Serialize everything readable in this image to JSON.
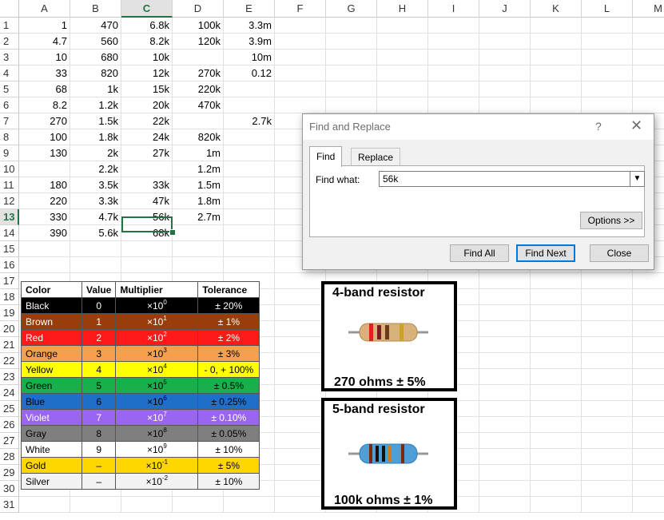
{
  "columns": [
    "A",
    "B",
    "C",
    "D",
    "E",
    "F",
    "G",
    "H",
    "I",
    "J",
    "K",
    "L",
    "M"
  ],
  "rows": [
    "1",
    "2",
    "3",
    "4",
    "5",
    "6",
    "7",
    "8",
    "9",
    "10",
    "11",
    "12",
    "13",
    "14",
    "15",
    "16",
    "17",
    "18",
    "19",
    "20",
    "21",
    "22",
    "23",
    "24",
    "25",
    "26",
    "27",
    "28",
    "29",
    "30",
    "31"
  ],
  "cells": [
    [
      "1",
      "470",
      "6.8k",
      "100k",
      "3.3m"
    ],
    [
      "4.7",
      "560",
      "8.2k",
      "120k",
      "3.9m"
    ],
    [
      "10",
      "680",
      "10k",
      "",
      "10m"
    ],
    [
      "33",
      "820",
      "12k",
      "270k",
      "0.12"
    ],
    [
      "68",
      "1k",
      "15k",
      "220k",
      ""
    ],
    [
      "8.2",
      "1.2k",
      "20k",
      "470k",
      ""
    ],
    [
      "270",
      "1.5k",
      "22k",
      "",
      "2.7k"
    ],
    [
      "100",
      "1.8k",
      "24k",
      "820k",
      ""
    ],
    [
      "130",
      "2k",
      "27k",
      "1m",
      ""
    ],
    [
      "",
      "2.2k",
      "",
      "1.2m",
      ""
    ],
    [
      "180",
      "3.5k",
      "33k",
      "1.5m",
      ""
    ],
    [
      "220",
      "3.3k",
      "47k",
      "1.8m",
      ""
    ],
    [
      "330",
      "4.7k",
      "56k",
      "2.7m",
      ""
    ],
    [
      "390",
      "5.6k",
      "68k",
      "",
      ""
    ]
  ],
  "color_table": {
    "headers": [
      "Color",
      "Value",
      "Multiplier",
      "Tolerance"
    ],
    "rows": [
      {
        "name": "Black",
        "value": "0",
        "exp": "0",
        "tol": "± 20%",
        "bg": "#000000",
        "fg": "#ffffff"
      },
      {
        "name": "Brown",
        "value": "1",
        "exp": "1",
        "tol": "± 1%",
        "bg": "#9a3d0a",
        "fg": "#ffffff"
      },
      {
        "name": "Red",
        "value": "2",
        "exp": "2",
        "tol": "± 2%",
        "bg": "#ff1a1a",
        "fg": "#ffffff"
      },
      {
        "name": "Orange",
        "value": "3",
        "exp": "3",
        "tol": "± 3%",
        "bg": "#f5a04d",
        "fg": "#000000"
      },
      {
        "name": "Yellow",
        "value": "4",
        "exp": "4",
        "tol": "- 0, + 100%",
        "bg": "#ffff00",
        "fg": "#000000"
      },
      {
        "name": "Green",
        "value": "5",
        "exp": "5",
        "tol": "± 0.5%",
        "bg": "#18b04a",
        "fg": "#000000"
      },
      {
        "name": "Blue",
        "value": "6",
        "exp": "6",
        "tol": "± 0.25%",
        "bg": "#1f6fc8",
        "fg": "#000000"
      },
      {
        "name": "Violet",
        "value": "7",
        "exp": "7",
        "tol": "± 0.10%",
        "bg": "#9a66f0",
        "fg": "#ffffff"
      },
      {
        "name": "Gray",
        "value": "8",
        "exp": "8",
        "tol": "± 0.05%",
        "bg": "#7f7f7f",
        "fg": "#000000"
      },
      {
        "name": "White",
        "value": "9",
        "exp": "9",
        "tol": "± 10%",
        "bg": "#ffffff",
        "fg": "#000000"
      },
      {
        "name": "Gold",
        "value": "–",
        "exp": "-1",
        "tol": "± 5%",
        "bg": "#ffd700",
        "fg": "#000000"
      },
      {
        "name": "Silver",
        "value": "–",
        "exp": "-2",
        "tol": "± 10%",
        "bg": "#f2f2f2",
        "fg": "#000000"
      }
    ]
  },
  "resistor4": {
    "title": "4-band resistor",
    "caption": "270 ohms ± 5%"
  },
  "resistor5": {
    "title": "5-band resistor",
    "caption": "100k ohms ± 1%"
  },
  "dialog": {
    "title": "Find and Replace",
    "help": "?",
    "close": "✕",
    "tabs": [
      "Find",
      "Replace"
    ],
    "find_label": "Find what:",
    "find_value": "56k",
    "options": "Options >>",
    "find_all": "Find All",
    "find_next": "Find Next",
    "close_btn": "Close"
  }
}
